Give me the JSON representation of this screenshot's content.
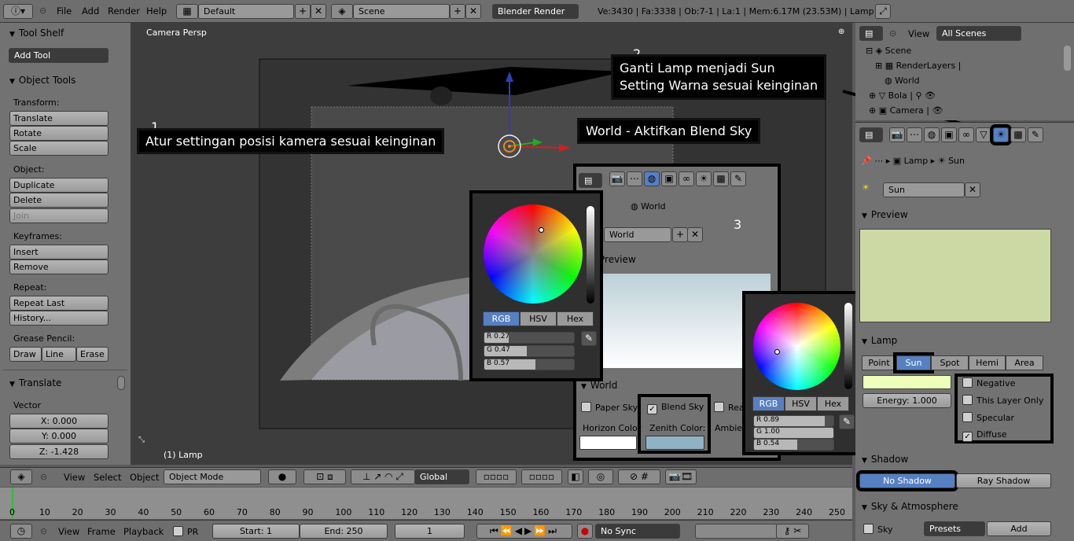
{
  "topbar": {
    "menu": [
      "File",
      "Add",
      "Render",
      "Help"
    ],
    "layout": "Default",
    "scene": "Scene",
    "engine": "Blender Render",
    "stats": "Ve:3430 | Fa:3338 | Ob:7-1 | La:1 | Mem:6.17M (23.53M) | Lamp"
  },
  "toolshelf": {
    "title": "Tool Shelf",
    "add_tool": "Add Tool",
    "object_tools": "Object Tools",
    "transform_label": "Transform:",
    "transform": [
      "Translate",
      "Rotate",
      "Scale"
    ],
    "object_label": "Object:",
    "object": [
      "Duplicate",
      "Delete",
      "Join"
    ],
    "keyframes_label": "Keyframes:",
    "keyframes": [
      "Insert",
      "Remove"
    ],
    "repeat_label": "Repeat:",
    "repeat": [
      "Repeat Last",
      "History..."
    ],
    "grease_label": "Grease Pencil:",
    "grease": [
      "Draw",
      "Line",
      "Erase"
    ],
    "translate_title": "Translate",
    "vector_label": "Vector",
    "x": "X: 0.000",
    "y": "Y: 0.000",
    "z": "Z: -1.428"
  },
  "viewport": {
    "title": "Camera Persp",
    "object_label": "(1) Lamp"
  },
  "annotations": {
    "n1": "1",
    "a1": "Atur settingan posisi kamera sesuai keinginan",
    "n2": "2",
    "a2_line1": "Ganti Lamp menjadi Sun",
    "a2_line2": "Setting Warna sesuai keinginan",
    "a3": "World - Aktifkan Blend Sky",
    "n3": "3"
  },
  "world_popup": {
    "breadcrumb": "World",
    "name": "World",
    "preview": "Preview",
    "section": "World",
    "paper_sky": "Paper Sky",
    "blend_sky": "Blend Sky",
    "real": "Rea",
    "horizon": "Horizon Color",
    "zenith": "Zenith Color:",
    "ambient": "Ambien",
    "horizon_color": "#ffffff",
    "zenith_color": "#8fb3c4"
  },
  "color_picker_1": {
    "tabs": [
      "RGB",
      "HSV",
      "Hex"
    ],
    "r": "R 0.27",
    "g": "G 0.47",
    "b": "B 0.57",
    "r_val": 0.27,
    "g_val": 0.47,
    "b_val": 0.57
  },
  "color_picker_2": {
    "tabs": [
      "RGB",
      "HSV",
      "Hex"
    ],
    "r": "R 0.89",
    "g": "G 1.00",
    "b": "B 0.54",
    "r_val": 0.89,
    "g_val": 1.0,
    "b_val": 0.54
  },
  "outliner": {
    "view": "View",
    "filter": "All Scenes",
    "items": [
      "Scene",
      "RenderLayers",
      "World",
      "Bola",
      "Camera"
    ]
  },
  "properties": {
    "breadcrumb_lamp": "Lamp",
    "breadcrumb_sun": "Sun",
    "name": "Sun",
    "preview": "Preview",
    "lamp_section": "Lamp",
    "lamp_types": [
      "Point",
      "Sun",
      "Spot",
      "Hemi",
      "Area"
    ],
    "energy": "Energy: 1.000",
    "negative": "Negative",
    "this_layer": "This Layer Only",
    "specular": "Specular",
    "diffuse": "Diffuse",
    "shadow_section": "Shadow",
    "no_shadow": "No Shadow",
    "ray_shadow": "Ray Shadow",
    "sky_section": "Sky & Atmosphere",
    "sky": "Sky",
    "presets": "Presets",
    "add": "Add",
    "preview_color": "#cdd9a5",
    "lamp_color": "#eeffbb"
  },
  "view3d_header": {
    "menu": [
      "View",
      "Select",
      "Object"
    ],
    "mode": "Object Mode",
    "orientation": "Global"
  },
  "timeline": {
    "ticks": [
      "0",
      "10",
      "20",
      "30",
      "40",
      "50",
      "60",
      "70",
      "80",
      "90",
      "100",
      "110",
      "120",
      "130",
      "140",
      "150",
      "160",
      "170",
      "180",
      "190",
      "200",
      "210",
      "220",
      "230",
      "240",
      "250"
    ],
    "menu": [
      "View",
      "Frame",
      "Playback"
    ],
    "pr": "PR",
    "start": "Start: 1",
    "end": "End: 250",
    "current": "1",
    "sync": "No Sync"
  }
}
